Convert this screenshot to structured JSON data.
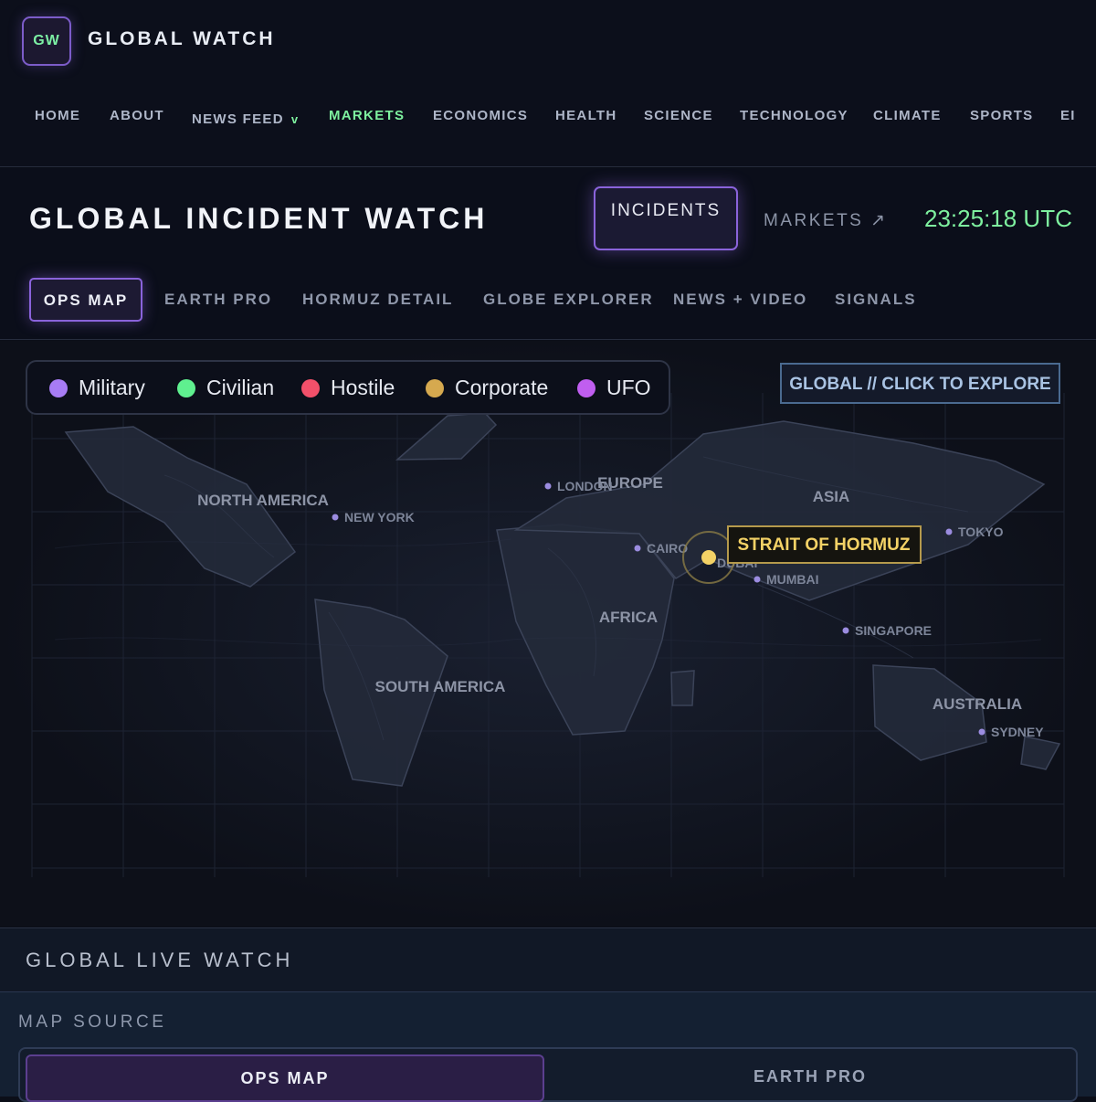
{
  "header": {
    "logo_text": "GW",
    "brand": "GLOBAL WATCH",
    "nav": [
      "HOME",
      "ABOUT",
      "NEWS FEED",
      "MARKETS",
      "ECONOMICS",
      "HEALTH",
      "SCIENCE",
      "TECHNOLOGY",
      "CLIMATE",
      "SPORTS",
      "EI"
    ],
    "nav_chevron": "v",
    "active_nav": "MARKETS"
  },
  "subheader": {
    "title": "GLOBAL INCIDENT WATCH",
    "incidents_label": "INCIDENTS",
    "markets_label": "MARKETS ↗",
    "clock": "23:25:18 UTC"
  },
  "tabs": [
    "OPS MAP",
    "EARTH PRO",
    "HORMUZ DETAIL",
    "GLOBE EXPLORER",
    "NEWS + VIDEO",
    "SIGNALS"
  ],
  "legend": [
    {
      "label": "Military",
      "color": "#a77cf4"
    },
    {
      "label": "Civilian",
      "color": "#5ff08f"
    },
    {
      "label": "Hostile",
      "color": "#f2506a"
    },
    {
      "label": "Corporate",
      "color": "#d6a94f"
    },
    {
      "label": "UFO",
      "color": "#c05ef0"
    }
  ],
  "explore_label": "GLOBAL // CLICK TO EXPLORE",
  "map": {
    "continents": [
      "NORTH AMERICA",
      "SOUTH AMERICA",
      "EUROPE",
      "AFRICA",
      "ASIA",
      "AUSTRALIA"
    ],
    "cities": [
      "NEW YORK",
      "LONDON",
      "CAIRO",
      "DUBAI",
      "MUMBAI",
      "TOKYO",
      "SINGAPORE",
      "SYDNEY"
    ],
    "highlight": "STRAIT OF HORMUZ",
    "highlight_color": "#f4d266"
  },
  "bottom": {
    "live_title": "GLOBAL LIVE WATCH",
    "source_label": "MAP SOURCE",
    "source_options": [
      "OPS MAP",
      "EARTH PRO"
    ]
  }
}
